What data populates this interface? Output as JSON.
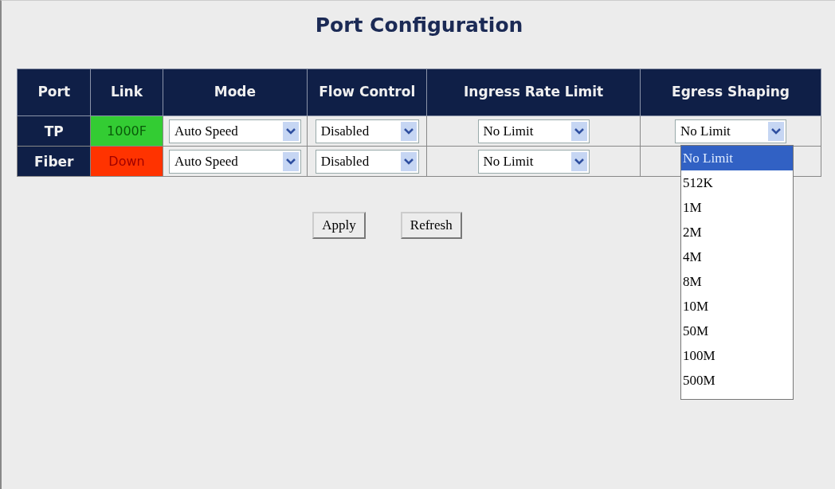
{
  "title": "Port Configuration",
  "columns": [
    "Port",
    "Link",
    "Mode",
    "Flow Control",
    "Ingress Rate Limit",
    "Egress Shaping"
  ],
  "ports": [
    {
      "name": "TP",
      "link": "1000F",
      "color": "#33cc33",
      "mode": "Auto Speed",
      "flow_control": "Disabled",
      "ingress": "No Limit",
      "egress": "No Limit",
      "egress_open": true
    },
    {
      "name": "Fiber",
      "link": "Down",
      "color": "#ff3300",
      "mode": "Auto Speed",
      "flow_control": "Disabled",
      "ingress": "No Limit",
      "egress_open": false
    }
  ],
  "egress_options": [
    {
      "label": "No Limit",
      "selected": true
    },
    {
      "label": "512K",
      "selected": false
    },
    {
      "label": "1M",
      "selected": false
    },
    {
      "label": "2M",
      "selected": false
    },
    {
      "label": "4M",
      "selected": false
    },
    {
      "label": "8M",
      "selected": false
    },
    {
      "label": "10M",
      "selected": false
    },
    {
      "label": "50M",
      "selected": false
    },
    {
      "label": "100M",
      "selected": false
    },
    {
      "label": "500M",
      "selected": false
    }
  ],
  "buttons": [
    "Apply",
    "Refresh"
  ]
}
